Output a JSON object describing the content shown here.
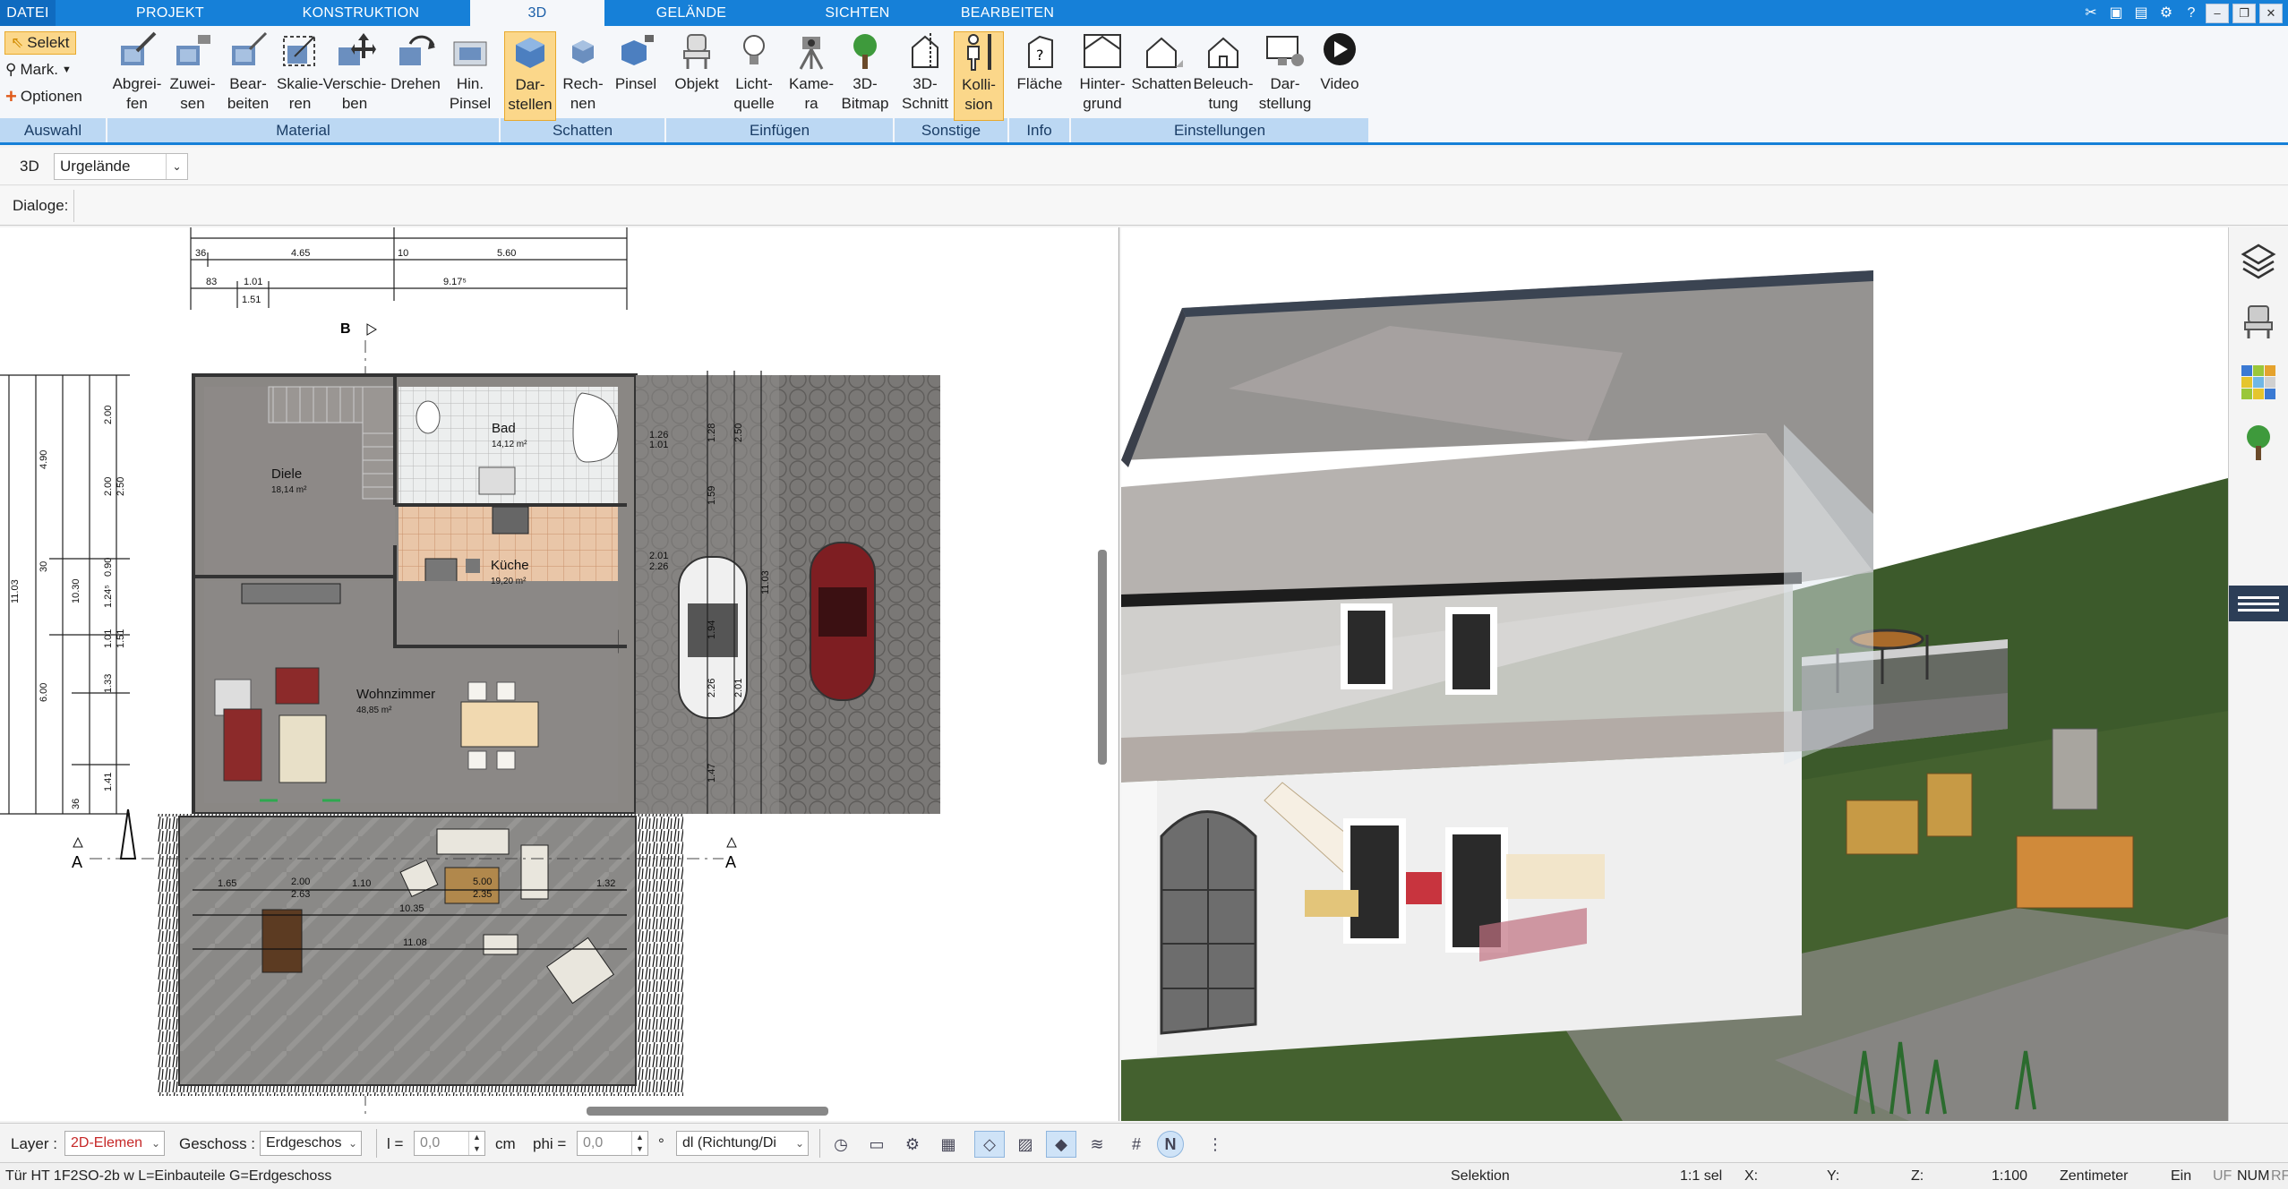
{
  "menu": {
    "tabs": [
      "DATEI",
      "PROJEKT",
      "KONSTRUKTION",
      "3D",
      "GELÄNDE",
      "SICHTEN",
      "BEARBEITEN"
    ],
    "active": "3D"
  },
  "ribbon": {
    "auswahl": {
      "selekt": "Selekt",
      "mark": "Mark.",
      "optionen": "Optionen",
      "group": "Auswahl"
    },
    "material": {
      "items": [
        "Abgrei-\nfen",
        "Zuwei-\nsen",
        "Bear-\nbeiten",
        "Skalie-\nren",
        "Verschie-\nben",
        "Drehen",
        "Hin.\nPinsel"
      ],
      "group": "Material"
    },
    "schatten": {
      "items": [
        "Dar-\nstellen",
        "Rech-\nnen",
        "Pinsel"
      ],
      "group": "Schatten"
    },
    "einfuegen": {
      "items": [
        "Objekt",
        "Licht-\nquelle",
        "Kame-\nra",
        "3D-\nBitmap"
      ],
      "group": "Einfügen"
    },
    "sonstige": {
      "items": [
        "3D-\nSchnitt",
        "Kolli-\nsion"
      ],
      "group": "Sonstige"
    },
    "info": {
      "items": [
        "Fläche"
      ],
      "group": "Info"
    },
    "einstellungen": {
      "items": [
        "Hinter-\ngrund",
        "Schatten",
        "Beleuch-\ntung",
        "Dar-\nstellung",
        "Video"
      ],
      "group": "Einstellungen"
    }
  },
  "toolbar": {
    "mode": "3D",
    "terrain": "Urgelände",
    "dialoge": "Dialoge:"
  },
  "plan": {
    "rooms": [
      {
        "name": "Diele",
        "area": "18,14 m²"
      },
      {
        "name": "Bad",
        "area": "14,12 m²"
      },
      {
        "name": "Küche",
        "area": "19,20 m²"
      },
      {
        "name": "Wohnzimmer",
        "area": "48,85 m²"
      }
    ],
    "dims_top": [
      "4.65",
      "5.60",
      "9.17⁵",
      "1.01",
      "1.51",
      "36",
      "83",
      "10"
    ],
    "dims_left": [
      "4.90",
      "11.03",
      "10.30",
      "6.00",
      "2.00",
      "2.00",
      "2.50",
      "1.33",
      "1.01",
      "1.51",
      "1.41",
      "0.90",
      "1.24⁵",
      "30",
      "36"
    ],
    "dims_terrace": [
      "1.65",
      "2.00",
      "2.63",
      "1.10",
      "5.00",
      "2.35",
      "1.32",
      "10.35",
      "11.08"
    ],
    "dims_garage": [
      "1.26",
      "1.01",
      "2.01",
      "2.26",
      "1.28",
      "1.59",
      "1.94",
      "2.26",
      "1.47",
      "2.01",
      "2.50",
      "11.03"
    ],
    "section_marks": [
      "B",
      "A",
      "A"
    ]
  },
  "params": {
    "layer_label": "Layer :",
    "layer_value": "2D-Elemen",
    "geschoss_label": "Geschoss :",
    "geschoss_value": "Erdgeschos",
    "l_label": "l =",
    "l_value": "0,0",
    "l_unit": "cm",
    "phi_label": "phi =",
    "phi_value": "0,0",
    "phi_unit": "°",
    "dl_value": "dl (Richtung/Di"
  },
  "status": {
    "left": "Tür HT 1F2SO-2b w L=Einbauteile G=Erdgeschoss",
    "mode": "Selektion",
    "sel": "1:1 sel",
    "x": "X:",
    "y": "Y:",
    "z": "Z:",
    "scale": "1:100",
    "unit": "Zentimeter",
    "ein": "Ein",
    "flags": [
      "UF",
      "NUM",
      "RF"
    ]
  },
  "colors": {
    "accent": "#1680d8",
    "group_bg": "#bcd8f3",
    "selected": "#fbd78a",
    "sky": "#ffffff",
    "grass": "#3f5b2c"
  }
}
